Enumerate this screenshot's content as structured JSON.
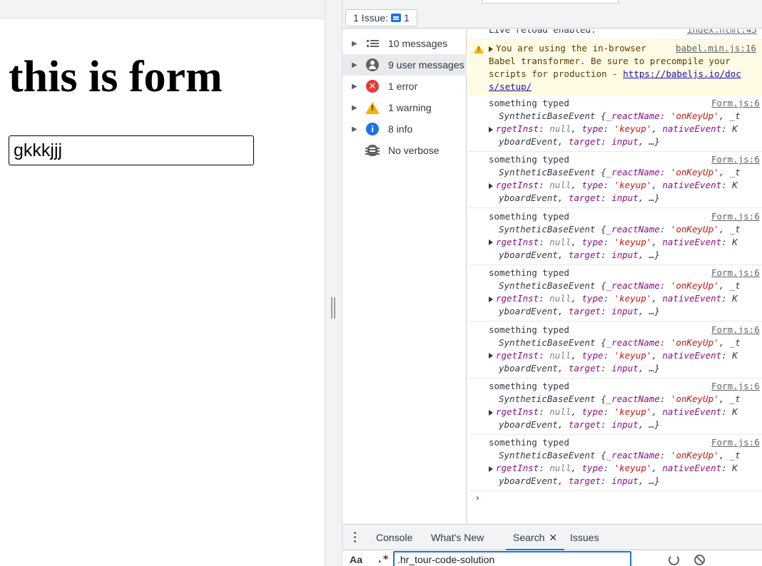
{
  "page": {
    "heading": "this is form",
    "input_value": "gkkkjjj"
  },
  "devtools": {
    "issues_button": {
      "prefix": "1 Issue:",
      "count": "1"
    },
    "sidebar": {
      "items": [
        {
          "label": "10 messages",
          "icon": "list-icon"
        },
        {
          "label": "9 user messages",
          "icon": "user-icon",
          "selected": true
        },
        {
          "label": "1 error",
          "icon": "error-icon"
        },
        {
          "label": "1 warning",
          "icon": "warning-icon"
        },
        {
          "label": "8 info",
          "icon": "info-icon"
        },
        {
          "label": "No verbose",
          "icon": "bug-icon"
        }
      ]
    },
    "console": {
      "live_reload": {
        "text": "Live reload enabled.",
        "source": "index.html:45"
      },
      "warning": {
        "line1": "You are using the in-browser",
        "source": "babel.min.js:16",
        "line2": "Babel transformer. Be sure to precompile your",
        "line3_prefix": "scripts for production - ",
        "link_part1": "https://babeljs.io/doc",
        "link_part2": "s/setup/"
      },
      "log_entry": {
        "message": "something typed",
        "source": "Form.js:6",
        "line2": {
          "head": "SyntheticBaseEvent {",
          "key1": "_reactName",
          "val1": "'onKeyUp'",
          "tail": ", _t"
        },
        "line3": {
          "head": "rgetInst",
          "val_null": "null",
          "key_type": "type",
          "val_type": "'keyup'",
          "key_native": "nativeEvent",
          "tail": "K"
        },
        "line4": {
          "head": "yboardEvent",
          "key_target": "target",
          "val_target": "input",
          "tail": ", …}"
        }
      },
      "log_count": 7
    },
    "drawer": {
      "tabs": [
        "Console",
        "What's New",
        "Search",
        "Issues"
      ],
      "active_tab": "Search"
    },
    "search": {
      "match_case_label": "Aa",
      "regex_label": ".*",
      "query": ".hr_tour-code-solution"
    }
  }
}
